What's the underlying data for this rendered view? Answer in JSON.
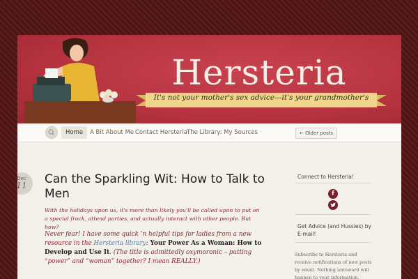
{
  "site": {
    "title": "Hersteria",
    "tagline": "It's not your mother's sex advice—it's your grandmother's"
  },
  "nav": {
    "items": [
      {
        "label": "Home",
        "active": true
      },
      {
        "label": "A Bit About Me",
        "active": false
      },
      {
        "label": "Contact Hersteria",
        "active": false
      },
      {
        "label": "The Library: My Sources",
        "active": false
      }
    ],
    "older_posts": "← Older posts"
  },
  "post": {
    "date_month": "Dec",
    "date_day": "11",
    "title": "Can the Sparkling Wit: How to Talk to Men",
    "intro": "With the holidays upon us, it's more than likely you'll be called upon to put on a special frock, attend parties, and actually interact with other people. But how?",
    "body_start": "Never fear! I have some quick ’n helpful tips for ladies from a new resource in the ",
    "body_link": "Hersteria library",
    "body_colon": ": ",
    "body_book": "Your Power As a Woman: How to Develop and Use It",
    "body_end": ". (The title is admittedly oxymoronic – putting “power” and “woman” together? I mean REALLY.)"
  },
  "sidebar": {
    "connect_title": "Connect to Hersteria!",
    "advice_title": "Get Advice (and Hussies) by E-mail!",
    "subscribe_text": "Subscribe to Hersteria and receive notifications of new posts by email. Nothing untoward will happen to your information. Promise."
  },
  "icons": {
    "search": "search-icon",
    "facebook": "facebook-icon",
    "twitter": "twitter-icon"
  },
  "colors": {
    "header_red": "#b5333f",
    "accent_maroon": "#8b2332",
    "social": "#7a1f2e",
    "ribbon": "#f0d68a"
  }
}
